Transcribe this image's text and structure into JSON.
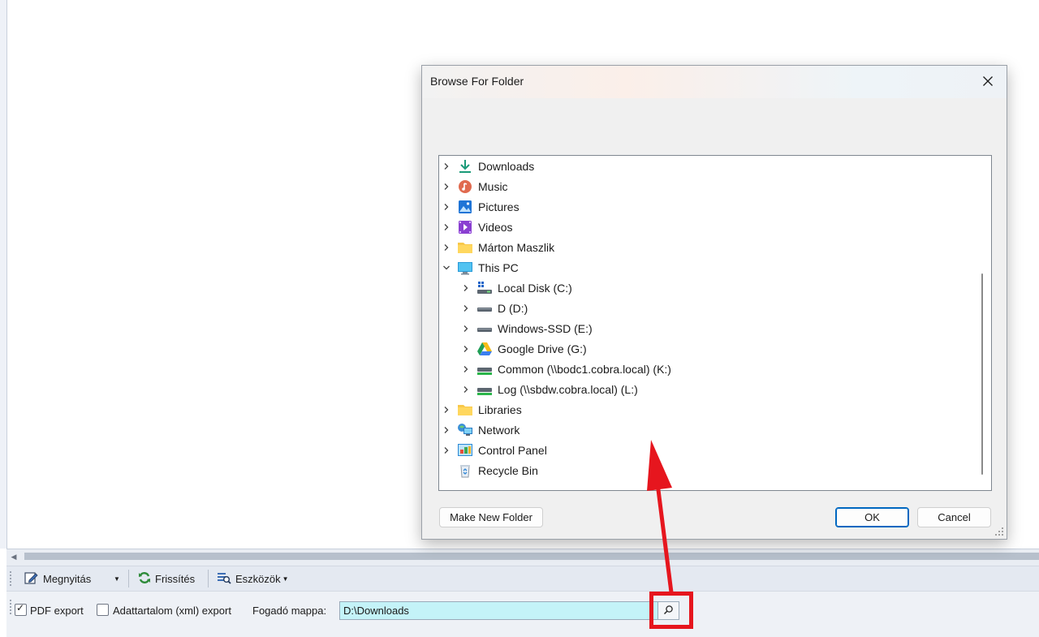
{
  "dialog": {
    "title": "Browse For Folder",
    "make_new_folder": "Make New Folder",
    "ok": "OK",
    "cancel": "Cancel",
    "tree": [
      {
        "label": "Downloads",
        "icon": "download-icon",
        "expanded": false
      },
      {
        "label": "Music",
        "icon": "music-icon",
        "expanded": false
      },
      {
        "label": "Pictures",
        "icon": "pictures-icon",
        "expanded": false
      },
      {
        "label": "Videos",
        "icon": "videos-icon",
        "expanded": false
      },
      {
        "label": "Márton Maszlik",
        "icon": "folder-icon",
        "expanded": false
      },
      {
        "label": "This PC",
        "icon": "computer-icon",
        "expanded": true
      },
      {
        "label": "Local Disk (C:)",
        "icon": "windows-drive-icon",
        "expanded": false
      },
      {
        "label": "D (D:)",
        "icon": "drive-icon",
        "expanded": false
      },
      {
        "label": "Windows-SSD (E:)",
        "icon": "drive-icon",
        "expanded": false
      },
      {
        "label": "Google Drive (G:)",
        "icon": "google-drive-icon",
        "expanded": false
      },
      {
        "label": "Common (\\\\bodc1.cobra.local) (K:)",
        "icon": "network-drive-icon",
        "expanded": false
      },
      {
        "label": "Log (\\\\sbdw.cobra.local) (L:)",
        "icon": "network-drive-icon",
        "expanded": false
      },
      {
        "label": "Libraries",
        "icon": "folder-icon",
        "expanded": false
      },
      {
        "label": "Network",
        "icon": "network-icon",
        "expanded": false
      },
      {
        "label": "Control Panel",
        "icon": "control-panel-icon",
        "expanded": false
      },
      {
        "label": "Recycle Bin",
        "icon": "recycle-bin-icon",
        "expanded": false
      }
    ]
  },
  "toolbar": {
    "open_label": "Megnyitás",
    "refresh_label": "Frissítés",
    "tools_label": "Eszközök"
  },
  "options": {
    "pdf_export_label": "PDF export",
    "pdf_export_checked": true,
    "xml_export_label": "Adattartalom (xml) export",
    "xml_export_checked": false,
    "target_folder_label": "Fogadó mappa:",
    "target_folder_value": "D:\\Downloads"
  },
  "colors": {
    "accent": "#0067c0",
    "highlight": "#e6161e",
    "input_bg": "#c4f3f8"
  }
}
